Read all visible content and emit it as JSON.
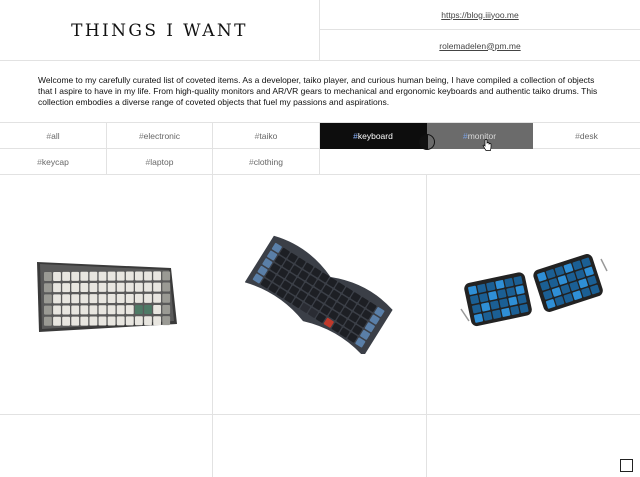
{
  "header": {
    "title": "THINGS I WANT",
    "blog_link": "https://blog.iiiyoo.me",
    "email_link": "rolemadelen@pm.me"
  },
  "intro": {
    "text": "Welcome to my carefully curated list of coveted items. As a developer, taiko player, and curious human being, I have compiled a collection of objects that I aspire to have in my life. From high-quality monitors and AR/VR gears to mechanical and ergonomic keyboards and authentic taiko drums. This collection embodies a diverse range of coveted objects that fuel my passions and aspirations."
  },
  "tags": [
    {
      "hash": "#",
      "label": "all",
      "state": "normal"
    },
    {
      "hash": "#",
      "label": "electronic",
      "state": "normal"
    },
    {
      "hash": "#",
      "label": "taiko",
      "state": "normal"
    },
    {
      "hash": "#",
      "label": "keyboard",
      "state": "active"
    },
    {
      "hash": "#",
      "label": "monitor",
      "state": "hover"
    },
    {
      "hash": "#",
      "label": "desk",
      "state": "normal"
    },
    {
      "hash": "#",
      "label": "keycap",
      "state": "normal"
    },
    {
      "hash": "#",
      "label": "laptop",
      "state": "normal"
    },
    {
      "hash": "#",
      "label": "clothing",
      "state": "normal"
    }
  ],
  "products": [
    {
      "name": "compact-mechanical-keyboard",
      "icon": "keyboard-image"
    },
    {
      "name": "alice-layout-keyboard",
      "icon": "keyboard-image"
    },
    {
      "name": "split-ergonomic-keyboard",
      "icon": "keyboard-image"
    }
  ],
  "colors": {
    "active_bg": "#0d0d0d",
    "hover_bg": "#6b6b6b",
    "border": "#e2e2e2",
    "accent_hash": "#8ab4ff"
  }
}
